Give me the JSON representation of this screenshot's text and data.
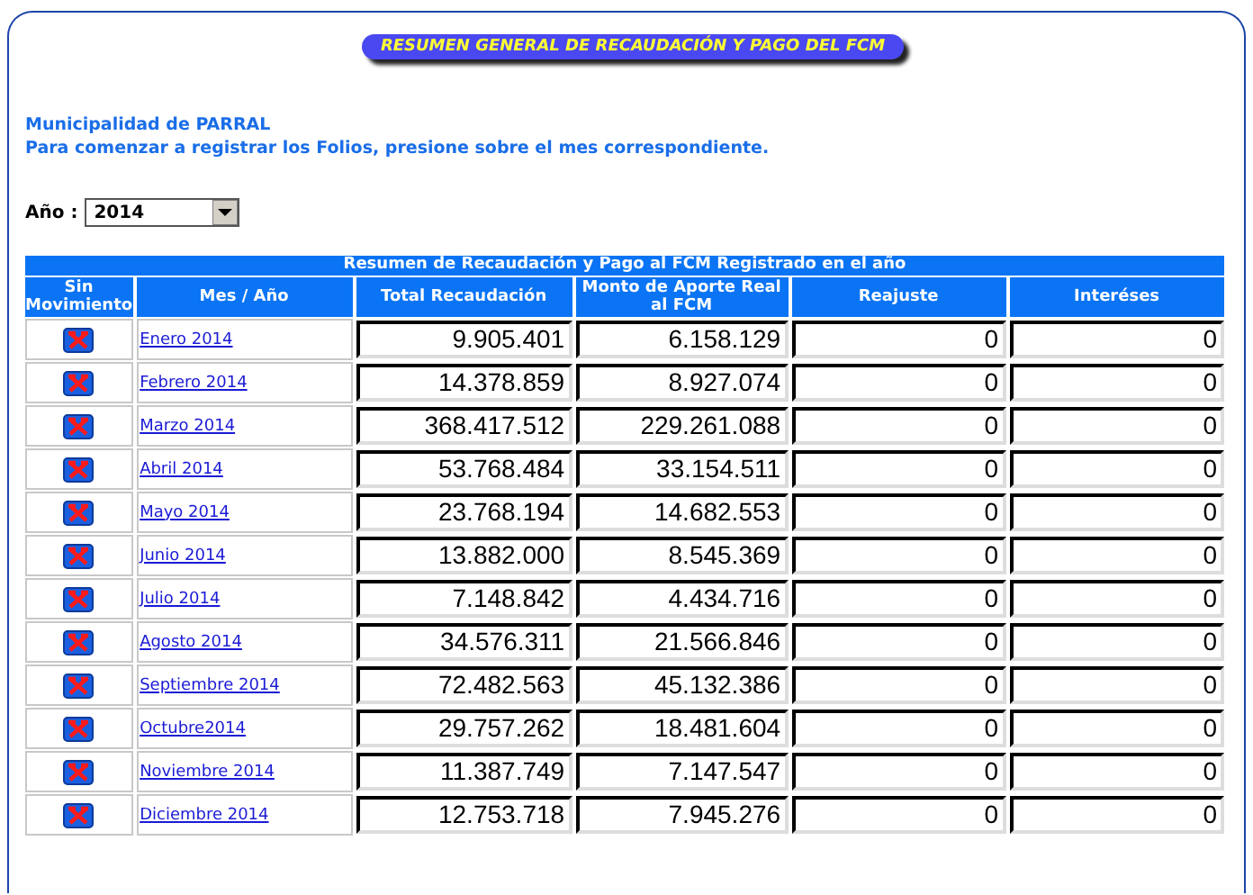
{
  "banner": "RESUMEN GENERAL DE RECAUDACIÓN Y PAGO DEL FCM",
  "municipality": "Municipalidad de PARRAL",
  "instruction": "Para comenzar a registrar los Folios, presione sobre el mes correspondiente.",
  "year_select": {
    "label": "Año :",
    "value": "2014"
  },
  "table": {
    "caption": "Resumen de Recaudación y Pago al FCM Registrado en el año",
    "columns": [
      "Sin Movimiento",
      "Mes / Año",
      "Total Recaudación",
      "Monto de Aporte Real al FCM",
      "Reajuste",
      "Interéses"
    ],
    "rows": [
      {
        "month": "Enero 2014",
        "total": "9.905.401",
        "aporte": "6.158.129",
        "reajuste": "0",
        "intereses": "0"
      },
      {
        "month": "Febrero 2014",
        "total": "14.378.859",
        "aporte": "8.927.074",
        "reajuste": "0",
        "intereses": "0"
      },
      {
        "month": "Marzo 2014",
        "total": "368.417.512",
        "aporte": "229.261.088",
        "reajuste": "0",
        "intereses": "0"
      },
      {
        "month": "Abril 2014",
        "total": "53.768.484",
        "aporte": "33.154.511",
        "reajuste": "0",
        "intereses": "0"
      },
      {
        "month": "Mayo 2014",
        "total": "23.768.194",
        "aporte": "14.682.553",
        "reajuste": "0",
        "intereses": "0"
      },
      {
        "month": "Junio 2014",
        "total": "13.882.000",
        "aporte": "8.545.369",
        "reajuste": "0",
        "intereses": "0"
      },
      {
        "month": "Julio 2014",
        "total": "7.148.842",
        "aporte": "4.434.716",
        "reajuste": "0",
        "intereses": "0"
      },
      {
        "month": "Agosto 2014",
        "total": "34.576.311",
        "aporte": "21.566.846",
        "reajuste": "0",
        "intereses": "0"
      },
      {
        "month": "Septiembre 2014",
        "total": "72.482.563",
        "aporte": "45.132.386",
        "reajuste": "0",
        "intereses": "0"
      },
      {
        "month": "Octubre2014",
        "total": "29.757.262",
        "aporte": "18.481.604",
        "reajuste": "0",
        "intereses": "0"
      },
      {
        "month": "Noviembre 2014",
        "total": "11.387.749",
        "aporte": "7.147.547",
        "reajuste": "0",
        "intereses": "0"
      },
      {
        "month": "Diciembre 2014",
        "total": "12.753.718",
        "aporte": "7.945.276",
        "reajuste": "0",
        "intereses": "0"
      }
    ]
  }
}
